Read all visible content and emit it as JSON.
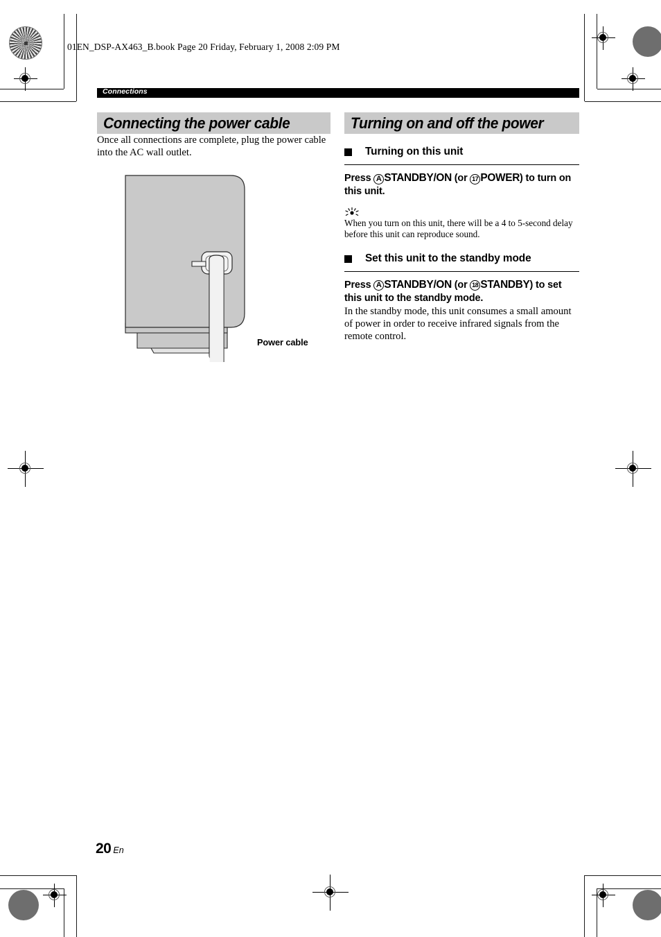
{
  "page": {
    "running_head": "01EN_DSP-AX463_B.book  Page 20  Friday, February 1, 2008  2:09 PM",
    "chapter": "Connections",
    "folio_number": "20",
    "folio_language": "En"
  },
  "left_column": {
    "section_title": "Connecting the power cable",
    "intro": "Once all connections are complete, plug the power cable into the AC wall outlet.",
    "figure": {
      "caption": "Power cable",
      "alt_name": "rear-panel-ac-inlet-illustration"
    }
  },
  "right_column": {
    "section_title": "Turning on and off the power",
    "subsections": [
      {
        "heading": "Turning on this unit",
        "instruction": {
          "lead": "Press ",
          "marker_1": "A",
          "control_1": "STANDBY/ON",
          "mid": " (or ",
          "marker_2": "17",
          "control_2": "POWER",
          "tail": ") to turn on this unit."
        },
        "tip_icon": "tip-sun-icon",
        "note": "When you turn on this unit, there will be a 4 to 5-second delay before this unit can reproduce sound."
      },
      {
        "heading": "Set this unit to the standby mode",
        "instruction": {
          "lead": "Press ",
          "marker_1": "A",
          "control_1": "STANDBY/ON",
          "mid": " (or ",
          "marker_2": "18",
          "control_2": "STANDBY",
          "tail": ") to set this unit to the standby mode."
        },
        "body": "In the standby mode, this unit consumes a small amount of power in order to receive infrared signals from the remote control."
      }
    ]
  },
  "colors": {
    "section_bar": "#c9c9c9",
    "chapter_bar": "#000000",
    "panel_fill": "#c9c9c9",
    "cable_fill": "#f2f2f2"
  }
}
